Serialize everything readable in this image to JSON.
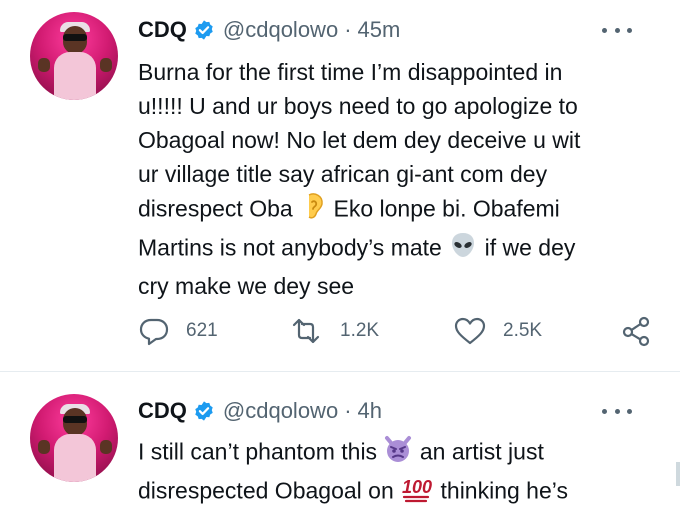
{
  "tweets": [
    {
      "name": "CDQ",
      "handle": "@cdqolowo",
      "separator": "·",
      "time": "45m",
      "lines": [
        "Burna for the first time I’m disappointed in",
        "u!!!!! U and ur boys need to go apologize to",
        "Obagoal now! No let dem dey deceive u wit",
        "ur village title say african gi-ant com dey",
        "disrespect Oba",
        "Eko lonpe bi. Obafemi",
        "Martins is not anybody’s mate",
        "if we dey",
        "cry make we dey see"
      ],
      "replies": "621",
      "retweets": "1.2K",
      "likes": "2.5K"
    },
    {
      "name": "CDQ",
      "handle": "@cdqolowo",
      "separator": "·",
      "time": "4h",
      "lines": [
        "I still can’t phantom this",
        "an artist just",
        "disrespected Obagoal on",
        "thinking he’s"
      ]
    }
  ],
  "icons": {
    "verified": "verified-badge-icon",
    "more": "more-dots-icon",
    "reply": "reply-icon",
    "retweet": "retweet-icon",
    "like": "heart-icon",
    "share": "share-icon",
    "ear": "ear-emoji",
    "alien": "alien-emoji",
    "devil": "angry-devil-emoji",
    "hundred": "hundred-points-emoji"
  },
  "colors": {
    "text": "#0f1419",
    "secondary": "#536471",
    "verified": "#1d9bf0",
    "avatar_bg": "#d21b72"
  }
}
